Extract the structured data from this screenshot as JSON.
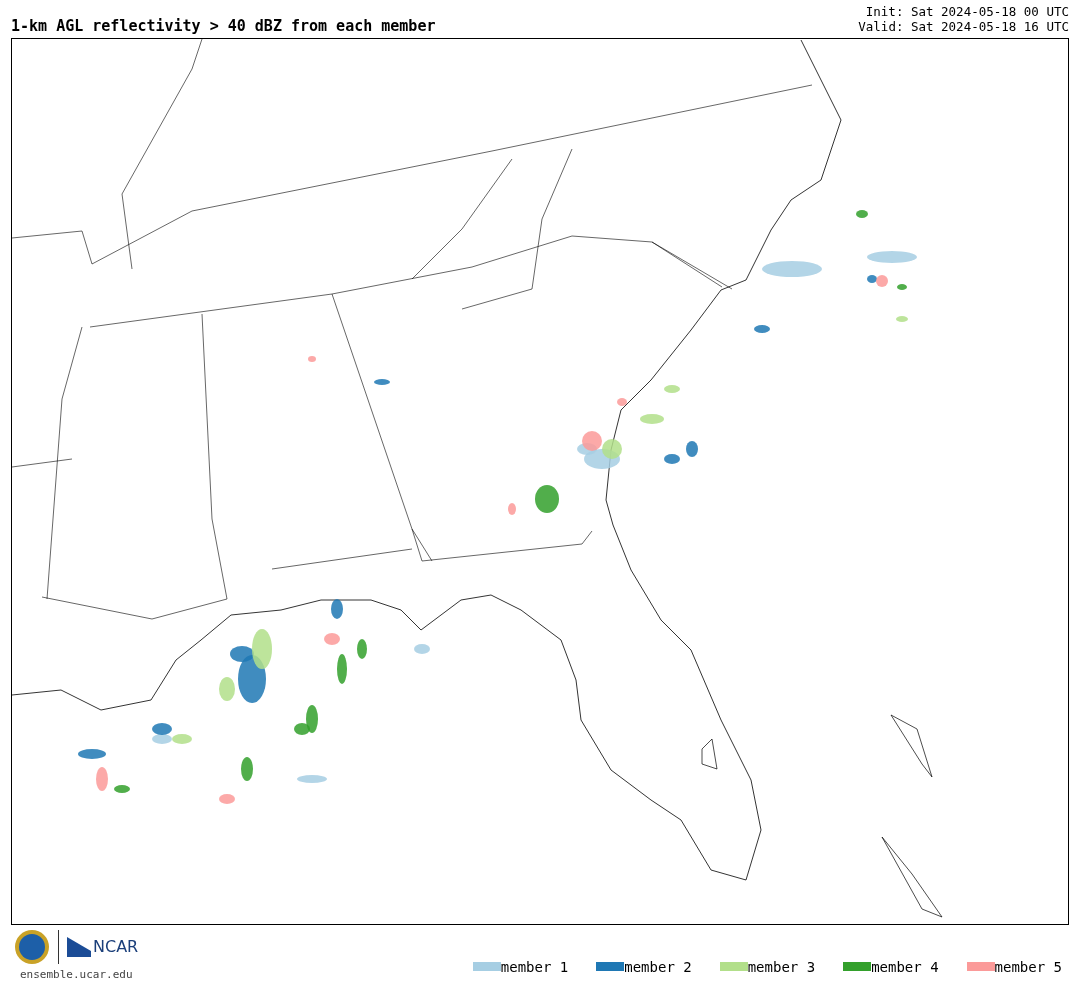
{
  "title": "1-km AGL reflectivity > 40 dBZ from each member",
  "init": "Init: Sat 2024-05-18 00 UTC",
  "valid": "Valid: Sat 2024-05-18 16 UTC",
  "logo": {
    "name": "NCAR",
    "url": "ensemble.ucar.edu"
  },
  "legend": [
    {
      "label": "member 1",
      "color": "#a6cee3"
    },
    {
      "label": "member 2",
      "color": "#1f78b4"
    },
    {
      "label": "member 3",
      "color": "#b2df8a"
    },
    {
      "label": "member 4",
      "color": "#33a02c"
    },
    {
      "label": "member 5",
      "color": "#fb9a99"
    }
  ]
}
